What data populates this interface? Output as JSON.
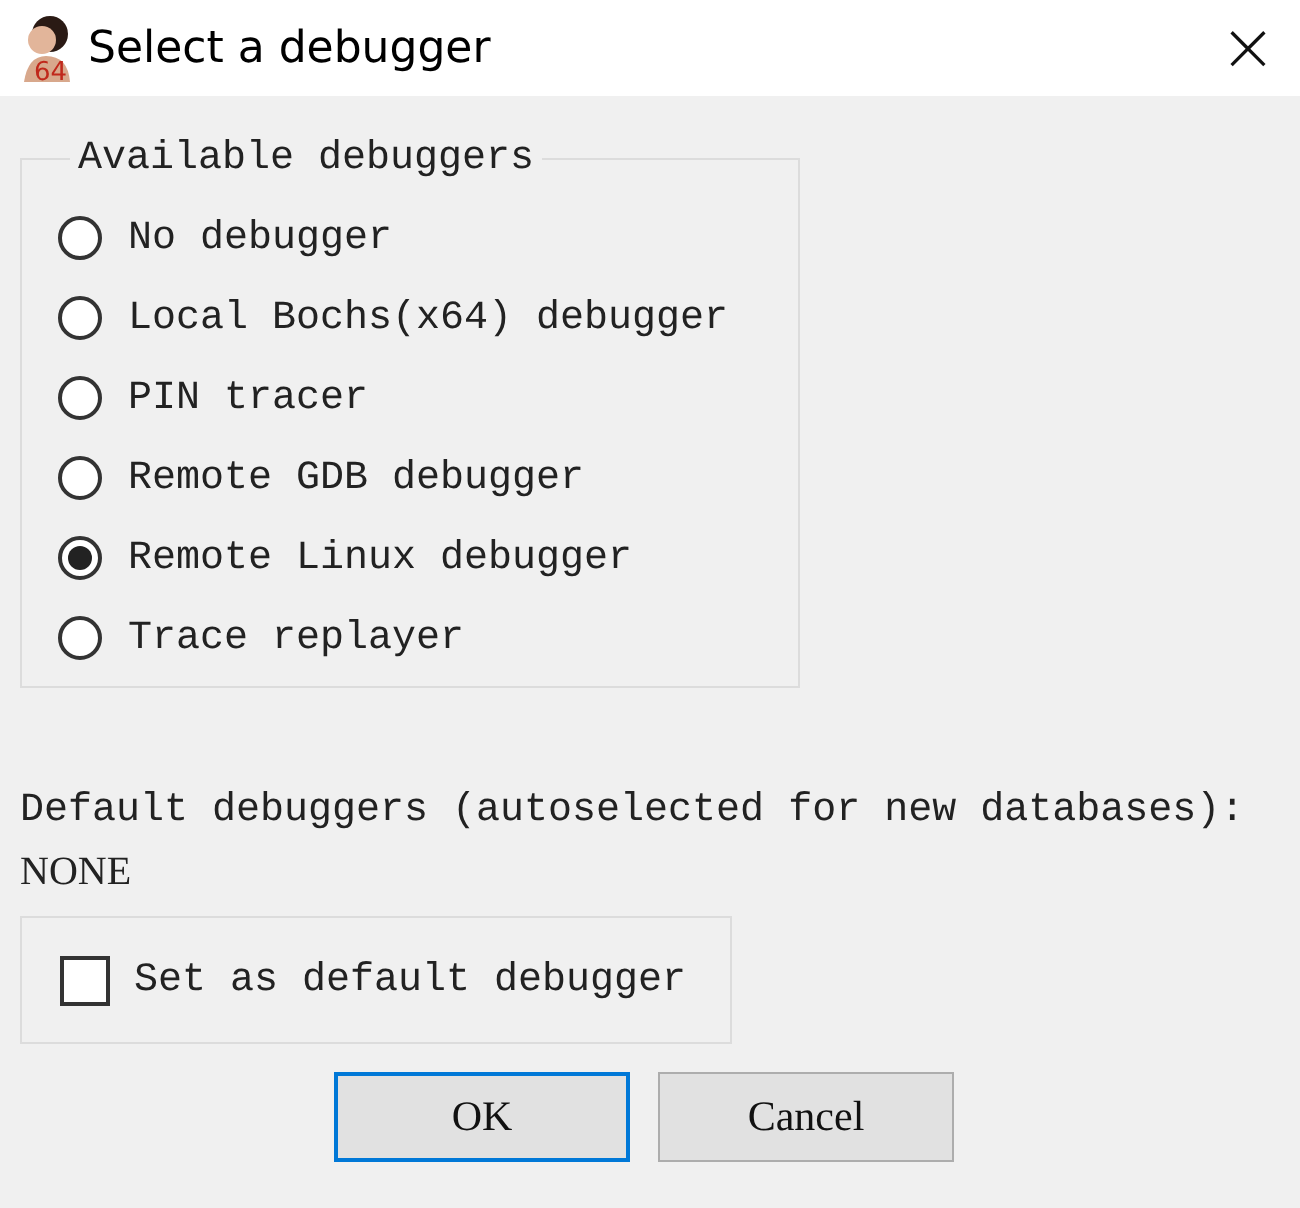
{
  "window": {
    "title": "Select a debugger",
    "icon_badge": "64",
    "close": "×"
  },
  "debuggers": {
    "legend": "Available debuggers",
    "options": [
      {
        "label": "No debugger",
        "selected": false
      },
      {
        "label": "Local Bochs(x64) debugger",
        "selected": false
      },
      {
        "label": "PIN tracer",
        "selected": false
      },
      {
        "label": "Remote GDB debugger",
        "selected": false
      },
      {
        "label": "Remote Linux debugger",
        "selected": true
      },
      {
        "label": "Trace replayer",
        "selected": false
      }
    ]
  },
  "default_label": "Default debuggers (autoselected for new databases):",
  "default_value": "NONE",
  "set_default": {
    "label": "Set as default debugger",
    "checked": false
  },
  "buttons": [
    {
      "label": "OK",
      "focused": true
    },
    {
      "label": "Cancel",
      "focused": false
    }
  ]
}
